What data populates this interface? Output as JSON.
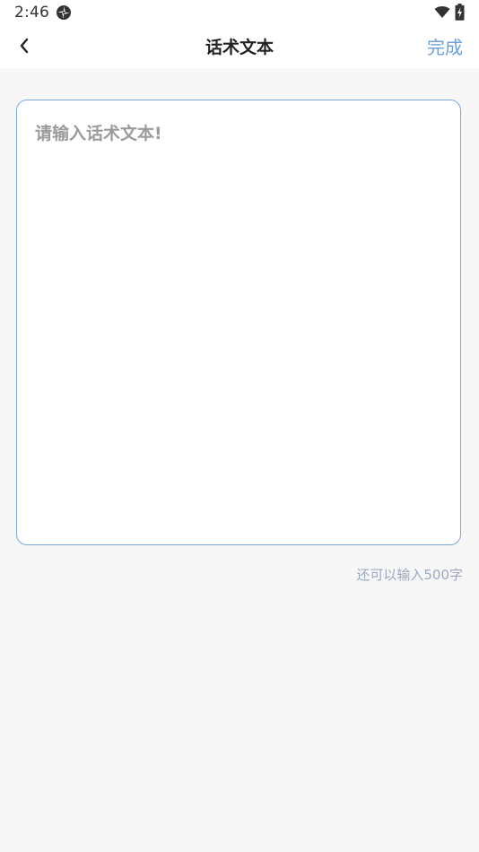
{
  "status_bar": {
    "time": "2:46",
    "app_icon": "compass-icon",
    "wifi_icon": "wifi-icon",
    "battery_icon": "battery-icon"
  },
  "nav": {
    "back_icon": "chevron-left-icon",
    "title": "话术文本",
    "done_label": "完成"
  },
  "editor": {
    "placeholder": "请输入话术文本!",
    "value": "",
    "counter_text": "还可以输入500字"
  },
  "colors": {
    "accent": "#6f9fd8",
    "border": "#7aa6dd",
    "background": "#f7f7f7",
    "placeholder": "#9b9b9b",
    "counter": "#9aa9bf"
  }
}
